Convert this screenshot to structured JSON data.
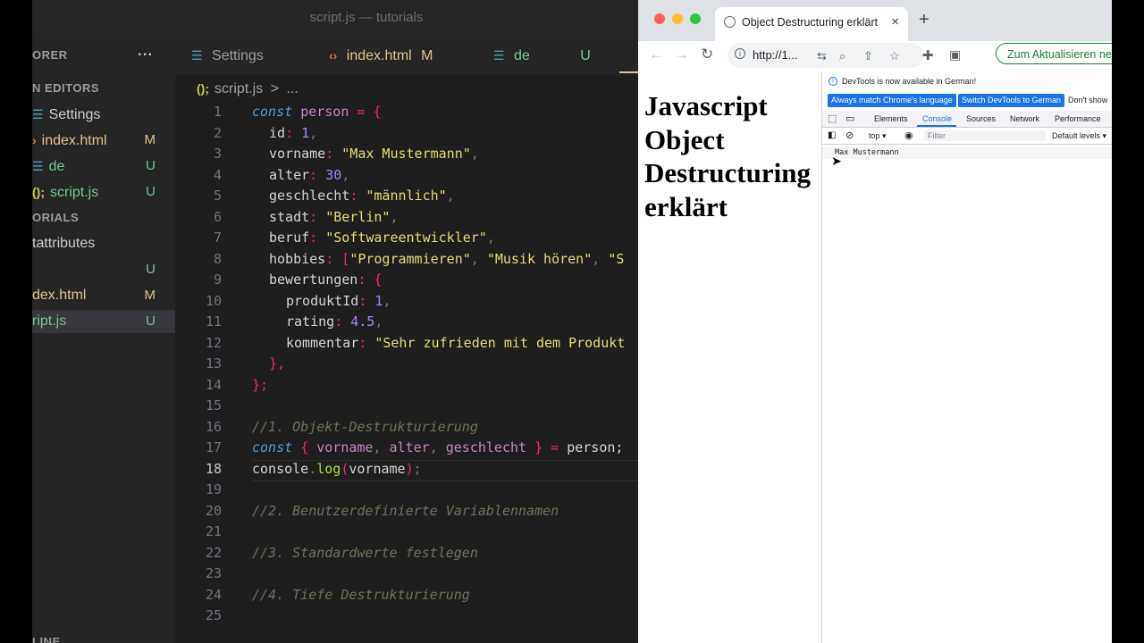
{
  "vscode": {
    "window_title": "script.js — tutorials",
    "sidebar": {
      "explorer_label": "ORER",
      "more_actions": "···",
      "open_editors_label": "N EDITORS",
      "open_editors": [
        {
          "name": "Settings",
          "status": ""
        },
        {
          "name": "index.html",
          "status": "M"
        },
        {
          "name": "de",
          "status": "U"
        },
        {
          "name": "script.js",
          "status": "U"
        }
      ],
      "folder_label": "ORIALS",
      "files": [
        {
          "name": "tattributes",
          "status": ""
        },
        {
          "name": "",
          "status": "U"
        },
        {
          "name": "dex.html",
          "status": "M"
        },
        {
          "name": "ript.js",
          "status": "U"
        }
      ],
      "outline_label": "LINE"
    },
    "tabs": [
      {
        "label": "Settings",
        "status": ""
      },
      {
        "label": "index.html",
        "status": "M"
      },
      {
        "label": "de",
        "status": "U"
      }
    ],
    "breadcrumb": {
      "file": "script.js",
      "separator": ">",
      "rest": "..."
    },
    "current_line": 18,
    "code": {
      "l1": {
        "kw": "const",
        "name": "person",
        "eq": "=",
        "open": "{"
      },
      "l2": {
        "key": "id",
        "value": "1"
      },
      "l3": {
        "key": "vorname",
        "value": "\"Max Mustermann\""
      },
      "l4": {
        "key": "alter",
        "value": "30"
      },
      "l5": {
        "key": "geschlecht",
        "value": "\"männlich\""
      },
      "l6": {
        "key": "stadt",
        "value": "\"Berlin\""
      },
      "l7": {
        "key": "beruf",
        "value": "\"Softwareentwickler\""
      },
      "l8": {
        "key": "hobbies",
        "value1": "\"Programmieren\"",
        "value2": "\"Musik hören\"",
        "value3": "\"S"
      },
      "l9": {
        "key": "bewertungen",
        "open": "{"
      },
      "l10": {
        "key": "produktId",
        "value": "1"
      },
      "l11": {
        "key": "rating",
        "value": "4.5"
      },
      "l12": {
        "key": "kommentar",
        "value": "\"Sehr zufrieden mit dem Produkt"
      },
      "l13": {
        "close": "},"
      },
      "l14": {
        "close": "};"
      },
      "l16": {
        "comment": "//1. Objekt-Destrukturierung"
      },
      "l17": {
        "kw": "const",
        "a": "vorname",
        "b": "alter",
        "c": "geschlecht",
        "rhs": "person;"
      },
      "l18": {
        "obj": "console",
        "fn": "log",
        "arg": "vorname"
      },
      "l20": {
        "comment": "//2. Benutzerdefinierte Variablennamen"
      },
      "l22": {
        "comment": "//3. Standardwerte festlegen"
      },
      "l24": {
        "comment": "//4. Tiefe Destrukturierung"
      }
    }
  },
  "chrome": {
    "tab_title": "Object Destructuring erklärt",
    "tab_close": "×",
    "new_tab": "+",
    "url": "http://1...",
    "update_button": "Zum Aktualisieren neu starten",
    "page_heading": "Javascript Object Destructuring erklärt",
    "devtools": {
      "notice": "DevTools is now available in German!",
      "btn_match": "Always match Chrome's language",
      "btn_switch": "Switch DevTools to German",
      "btn_dont_show": "Don't show",
      "tabs": [
        "Elements",
        "Console",
        "Sources",
        "Network",
        "Performance"
      ],
      "active_tab": "Console",
      "context": "top",
      "filter_placeholder": "Filter",
      "levels": "Default levels",
      "log_output": "Max Mustermann"
    }
  },
  "colors": {
    "vscode_bg": "#1e1e1e",
    "sidebar_bg": "#252526",
    "modified": "#e2c08d",
    "untracked": "#73c991",
    "keyword": "#569cd6",
    "string": "#e6db74",
    "number": "#ae81ff",
    "comment": "#75715e",
    "chrome_accent": "#1a73e8",
    "update_green": "#188038"
  }
}
